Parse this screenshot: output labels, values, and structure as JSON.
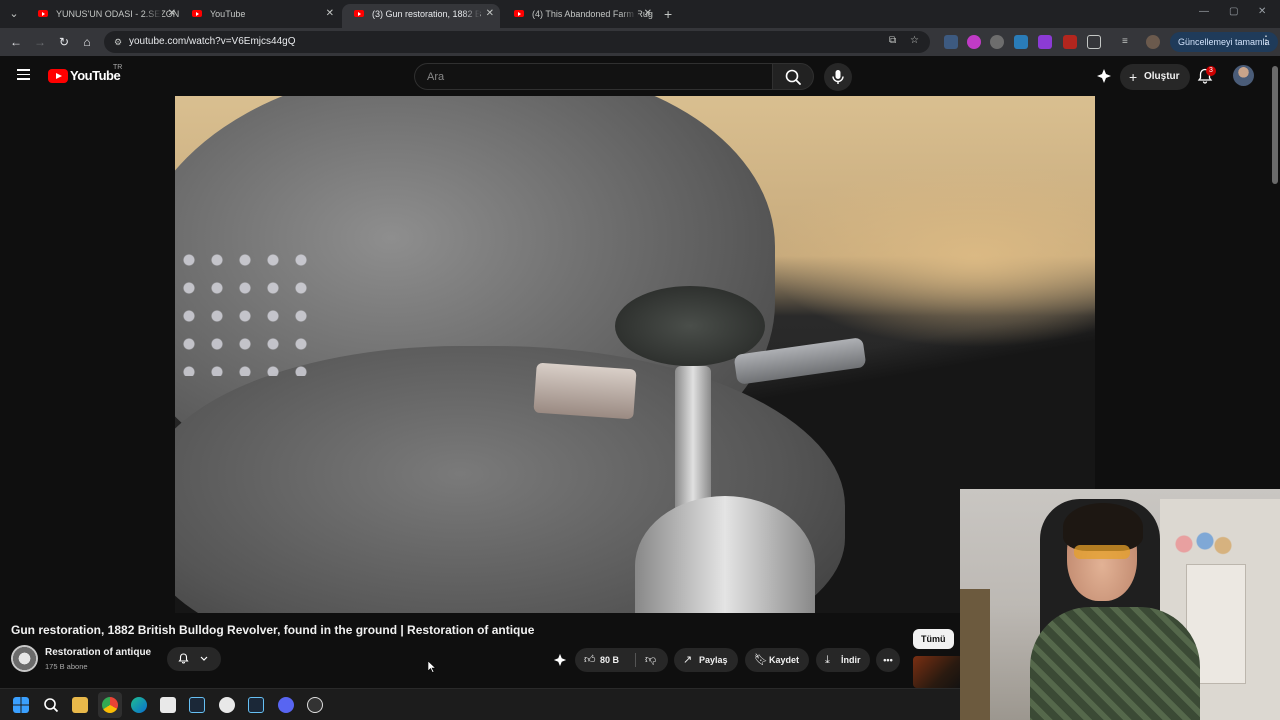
{
  "browser": {
    "tabs": [
      {
        "title": "YUNUS'UN ODASI - 2.SEZON 8",
        "active": false
      },
      {
        "title": "YouTube",
        "active": false
      },
      {
        "title": "(3) Gun restoration, 1882 B",
        "active": true
      },
      {
        "title": "(4) This Abandoned Farm Rug",
        "active": false
      }
    ],
    "url": "youtube.com/watch?v=V6Emjcs44gQ",
    "update_button": "Güncellemeyi tamamla"
  },
  "youtube": {
    "logo_text": "YouTube",
    "country_code": "TR",
    "search_placeholder": "Ara",
    "create_label": "Oluştur",
    "notification_count": "3"
  },
  "video": {
    "title": "Gun restoration, 1882 British Bulldog Revolver, found in the ground | Restoration of antique",
    "channel_name": "Restoration of antique",
    "subscribers": "175 B abone",
    "like_count": "80 B",
    "share_label": "Paylaş",
    "save_label": "Kaydet",
    "download_label": "İndir"
  },
  "sidebar_chip": "Tümü",
  "colors": {
    "yt_red": "#ff0000",
    "background": "#0f0f0f",
    "pill": "#272727"
  }
}
